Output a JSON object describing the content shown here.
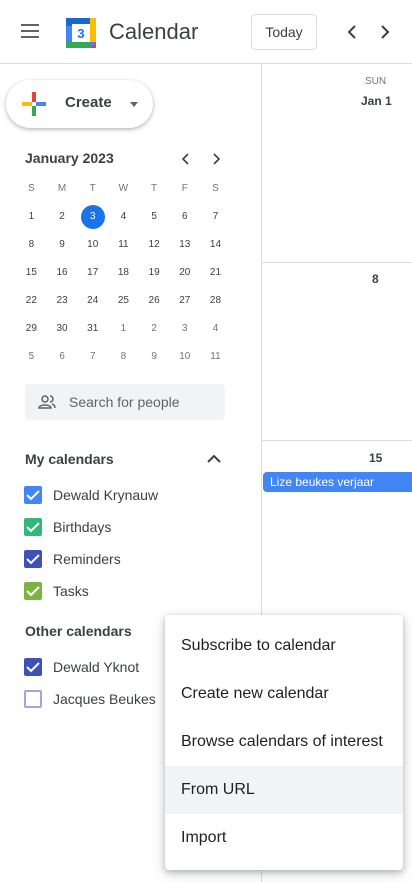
{
  "header": {
    "menu_icon": "hamburger-menu-icon",
    "logo_day": "3",
    "app_title": "Calendar",
    "today_label": "Today",
    "prev_icon": "chevron-left-icon",
    "next_icon": "chevron-right-icon"
  },
  "create": {
    "label": "Create",
    "icon": "multicolor-plus-icon",
    "caret_icon": "caret-down-icon"
  },
  "mini_calendar": {
    "title": "January 2023",
    "days_of_week": [
      "S",
      "M",
      "T",
      "W",
      "T",
      "F",
      "S"
    ],
    "weeks": [
      [
        "1",
        "2",
        "3",
        "4",
        "5",
        "6",
        "7"
      ],
      [
        "8",
        "9",
        "10",
        "11",
        "12",
        "13",
        "14"
      ],
      [
        "15",
        "16",
        "17",
        "18",
        "19",
        "20",
        "21"
      ],
      [
        "22",
        "23",
        "24",
        "25",
        "26",
        "27",
        "28"
      ],
      [
        "29",
        "30",
        "31",
        "1",
        "2",
        "3",
        "4"
      ],
      [
        "5",
        "6",
        "7",
        "8",
        "9",
        "10",
        "11"
      ]
    ],
    "today": "3",
    "accent_color": "#1a73e8"
  },
  "search_people": {
    "placeholder": "Search for people",
    "icon": "people-icon"
  },
  "my_calendars": {
    "title": "My calendars",
    "collapse_icon": "chevron-up-icon",
    "items": [
      {
        "label": "Dewald Krynauw",
        "color": "#4285f4",
        "checked": true
      },
      {
        "label": "Birthdays",
        "color": "#33b679",
        "checked": true
      },
      {
        "label": "Reminders",
        "color": "#3f51b5",
        "checked": true
      },
      {
        "label": "Tasks",
        "color": "#7cb342",
        "checked": true
      }
    ]
  },
  "other_calendars": {
    "title": "Other calendars",
    "items": [
      {
        "label": "Dewald Yknot",
        "color": "#3f51b5",
        "checked": true
      },
      {
        "label": "Jacques Beukes",
        "color": "#b39ddb",
        "checked": false
      }
    ]
  },
  "week_view": {
    "day_name": "SUN",
    "dates": [
      "Jan 1",
      "8",
      "15"
    ],
    "event": {
      "title": "Lize beukes verjaar",
      "color": "#4285f4"
    }
  },
  "menu": {
    "items": [
      "Subscribe to calendar",
      "Create new calendar",
      "Browse calendars of interest",
      "From URL",
      "Import"
    ],
    "highlighted": "From URL"
  }
}
